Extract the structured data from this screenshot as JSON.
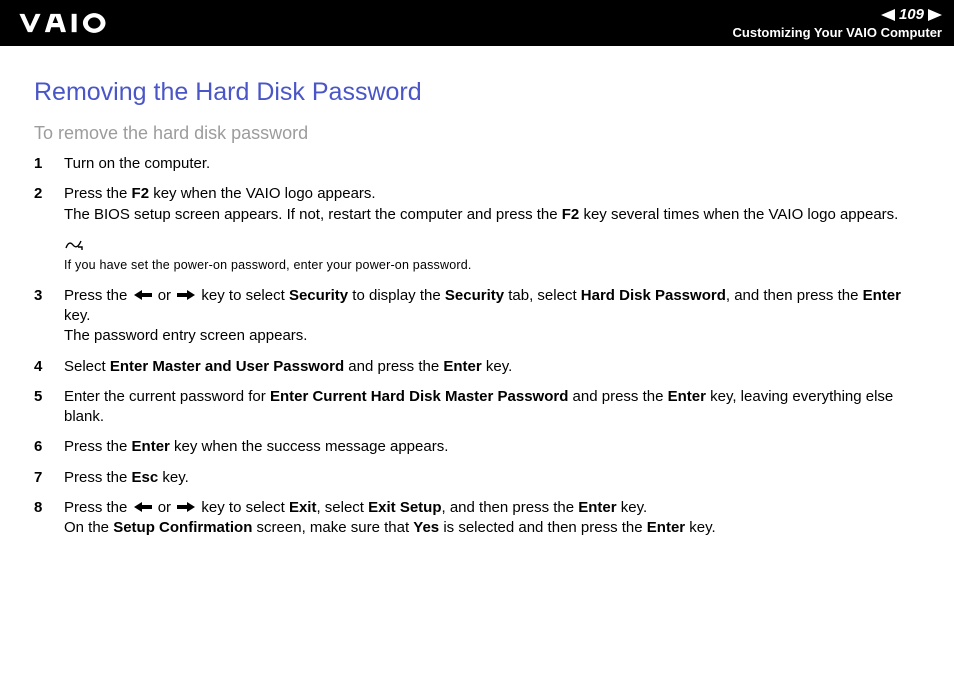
{
  "header": {
    "pageNumber": "109",
    "breadcrumb": "Customizing Your VAIO Computer"
  },
  "title": "Removing the Hard Disk Password",
  "subtitle": "To remove the hard disk password",
  "steps": {
    "s1": "Turn on the computer.",
    "s2a": "Press the ",
    "s2b": "F2",
    "s2c": " key when the VAIO logo appears.",
    "s2d": "The BIOS setup screen appears. If not, restart the computer and press the ",
    "s2e": "F2",
    "s2f": " key several times when the VAIO logo appears.",
    "note": "If you have set the power-on password, enter your power-on password.",
    "s3a": "Press the ",
    "s3b": " or ",
    "s3c": " key to select ",
    "s3d": "Security",
    "s3e": " to display the ",
    "s3f": "Security",
    "s3g": " tab, select ",
    "s3h": "Hard Disk Password",
    "s3i": ", and then press the ",
    "s3j": "Enter",
    "s3k": " key.",
    "s3l": "The password entry screen appears.",
    "s4a": "Select ",
    "s4b": "Enter Master and User Password",
    "s4c": " and press the ",
    "s4d": "Enter",
    "s4e": " key.",
    "s5a": "Enter the current password for ",
    "s5b": "Enter Current Hard Disk Master Password",
    "s5c": " and press the ",
    "s5d": "Enter",
    "s5e": " key, leaving everything else blank.",
    "s6a": "Press the ",
    "s6b": "Enter",
    "s6c": " key when the success message appears.",
    "s7a": "Press the ",
    "s7b": "Esc",
    "s7c": " key.",
    "s8a": "Press the ",
    "s8b": " or ",
    "s8c": " key to select ",
    "s8d": "Exit",
    "s8e": ", select ",
    "s8f": "Exit Setup",
    "s8g": ", and then press the ",
    "s8h": "Enter",
    "s8i": " key.",
    "s8j": "On the ",
    "s8k": "Setup Confirmation",
    "s8l": " screen, make sure that ",
    "s8m": "Yes",
    "s8n": " is selected and then press the ",
    "s8o": "Enter",
    "s8p": " key."
  }
}
